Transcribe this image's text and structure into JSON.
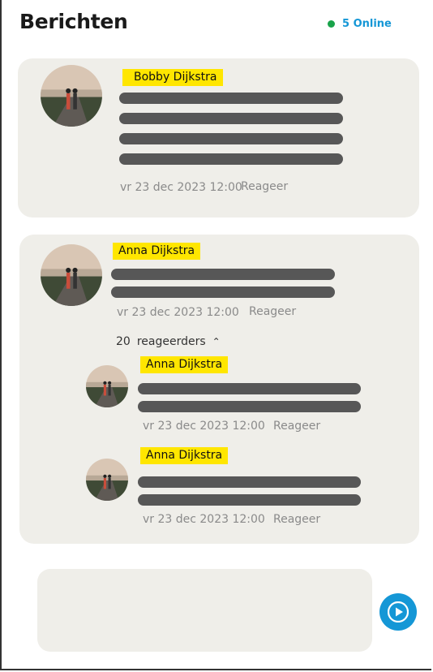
{
  "header": {
    "title": "Berichten",
    "online_label": "5 Online",
    "online_color": "#19a34a",
    "accent": "#1597d6"
  },
  "messages": [
    {
      "author": "Bobby Dijkstra",
      "timestamp": "vr 23 dec 2023 12:00",
      "reply_label": "Reageer"
    },
    {
      "author": "Anna Dijkstra",
      "timestamp": "vr 23 dec 2023 12:00",
      "reply_label": "Reageer",
      "replies_count": "20",
      "replies_label": "reageerders",
      "replies": [
        {
          "author": "Anna Dijkstra",
          "timestamp": "vr 23 dec 2023 12:00",
          "reply_label": "Reageer"
        },
        {
          "author": "Anna Dijkstra",
          "timestamp": "vr 23 dec 2023 12:00",
          "reply_label": "Reageer"
        }
      ]
    }
  ],
  "icons": {
    "send": "play-send-icon",
    "avatar": "avatar-photo",
    "toggle": "chevron-up-icon"
  }
}
